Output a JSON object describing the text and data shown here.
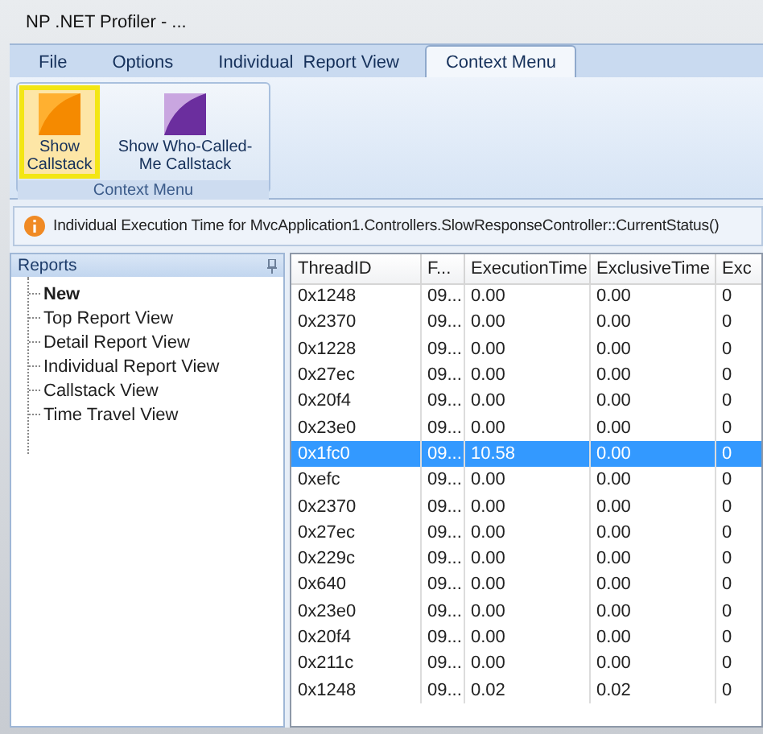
{
  "window": {
    "title": "NP .NET Profiler - ..."
  },
  "tabs": [
    {
      "label": "File",
      "selected": false
    },
    {
      "label": "Options",
      "selected": false
    },
    {
      "label": "Individual  Report View",
      "selected": false
    },
    {
      "label": "Context Menu",
      "selected": true
    }
  ],
  "ribbon": {
    "group_label": "Context Menu",
    "buttons": [
      {
        "label": "Show Callstack",
        "kind": "orange",
        "selected": true
      },
      {
        "label": "Show Who-Called-Me Callstack",
        "kind": "purple",
        "selected": false
      }
    ]
  },
  "info_bar": {
    "text": "Individual Execution Time for MvcApplication1.Controllers.SlowResponseController::CurrentStatus()"
  },
  "reports_panel": {
    "title": "Reports",
    "items": [
      {
        "label": "New",
        "selected": true
      },
      {
        "label": "Top Report View",
        "selected": false
      },
      {
        "label": "Detail Report View",
        "selected": false
      },
      {
        "label": "Individual Report View",
        "selected": false
      },
      {
        "label": "Callstack View",
        "selected": false
      },
      {
        "label": "Time Travel View",
        "selected": false
      }
    ]
  },
  "table": {
    "columns": [
      "ThreadID",
      "F...",
      "ExecutionTime",
      "ExclusiveTime",
      "Exc"
    ],
    "rows": [
      {
        "cells": [
          "0x1248",
          "09...",
          "0.00",
          "0.00",
          "0"
        ],
        "selected": false
      },
      {
        "cells": [
          "0x2370",
          "09...",
          "0.00",
          "0.00",
          "0"
        ],
        "selected": false
      },
      {
        "cells": [
          "0x1228",
          "09...",
          "0.00",
          "0.00",
          "0"
        ],
        "selected": false
      },
      {
        "cells": [
          "0x27ec",
          "09...",
          "0.00",
          "0.00",
          "0"
        ],
        "selected": false
      },
      {
        "cells": [
          "0x20f4",
          "09...",
          "0.00",
          "0.00",
          "0"
        ],
        "selected": false
      },
      {
        "cells": [
          "0x23e0",
          "09...",
          "0.00",
          "0.00",
          "0"
        ],
        "selected": false
      },
      {
        "cells": [
          "0x1fc0",
          "09...",
          "10.58",
          "0.00",
          "0"
        ],
        "selected": true
      },
      {
        "cells": [
          "0xefc",
          "09...",
          "0.00",
          "0.00",
          "0"
        ],
        "selected": false
      },
      {
        "cells": [
          "0x2370",
          "09...",
          "0.00",
          "0.00",
          "0"
        ],
        "selected": false
      },
      {
        "cells": [
          "0x27ec",
          "09...",
          "0.00",
          "0.00",
          "0"
        ],
        "selected": false
      },
      {
        "cells": [
          "0x229c",
          "09...",
          "0.00",
          "0.00",
          "0"
        ],
        "selected": false
      },
      {
        "cells": [
          "0x640",
          "09...",
          "0.00",
          "0.00",
          "0"
        ],
        "selected": false
      },
      {
        "cells": [
          "0x23e0",
          "09...",
          "0.00",
          "0.00",
          "0"
        ],
        "selected": false
      },
      {
        "cells": [
          "0x20f4",
          "09...",
          "0.00",
          "0.00",
          "0"
        ],
        "selected": false
      },
      {
        "cells": [
          "0x211c",
          "09...",
          "0.00",
          "0.00",
          "0"
        ],
        "selected": false
      },
      {
        "cells": [
          "0x1248",
          "09...",
          "0.02",
          "0.02",
          "0"
        ],
        "selected": false
      }
    ]
  }
}
